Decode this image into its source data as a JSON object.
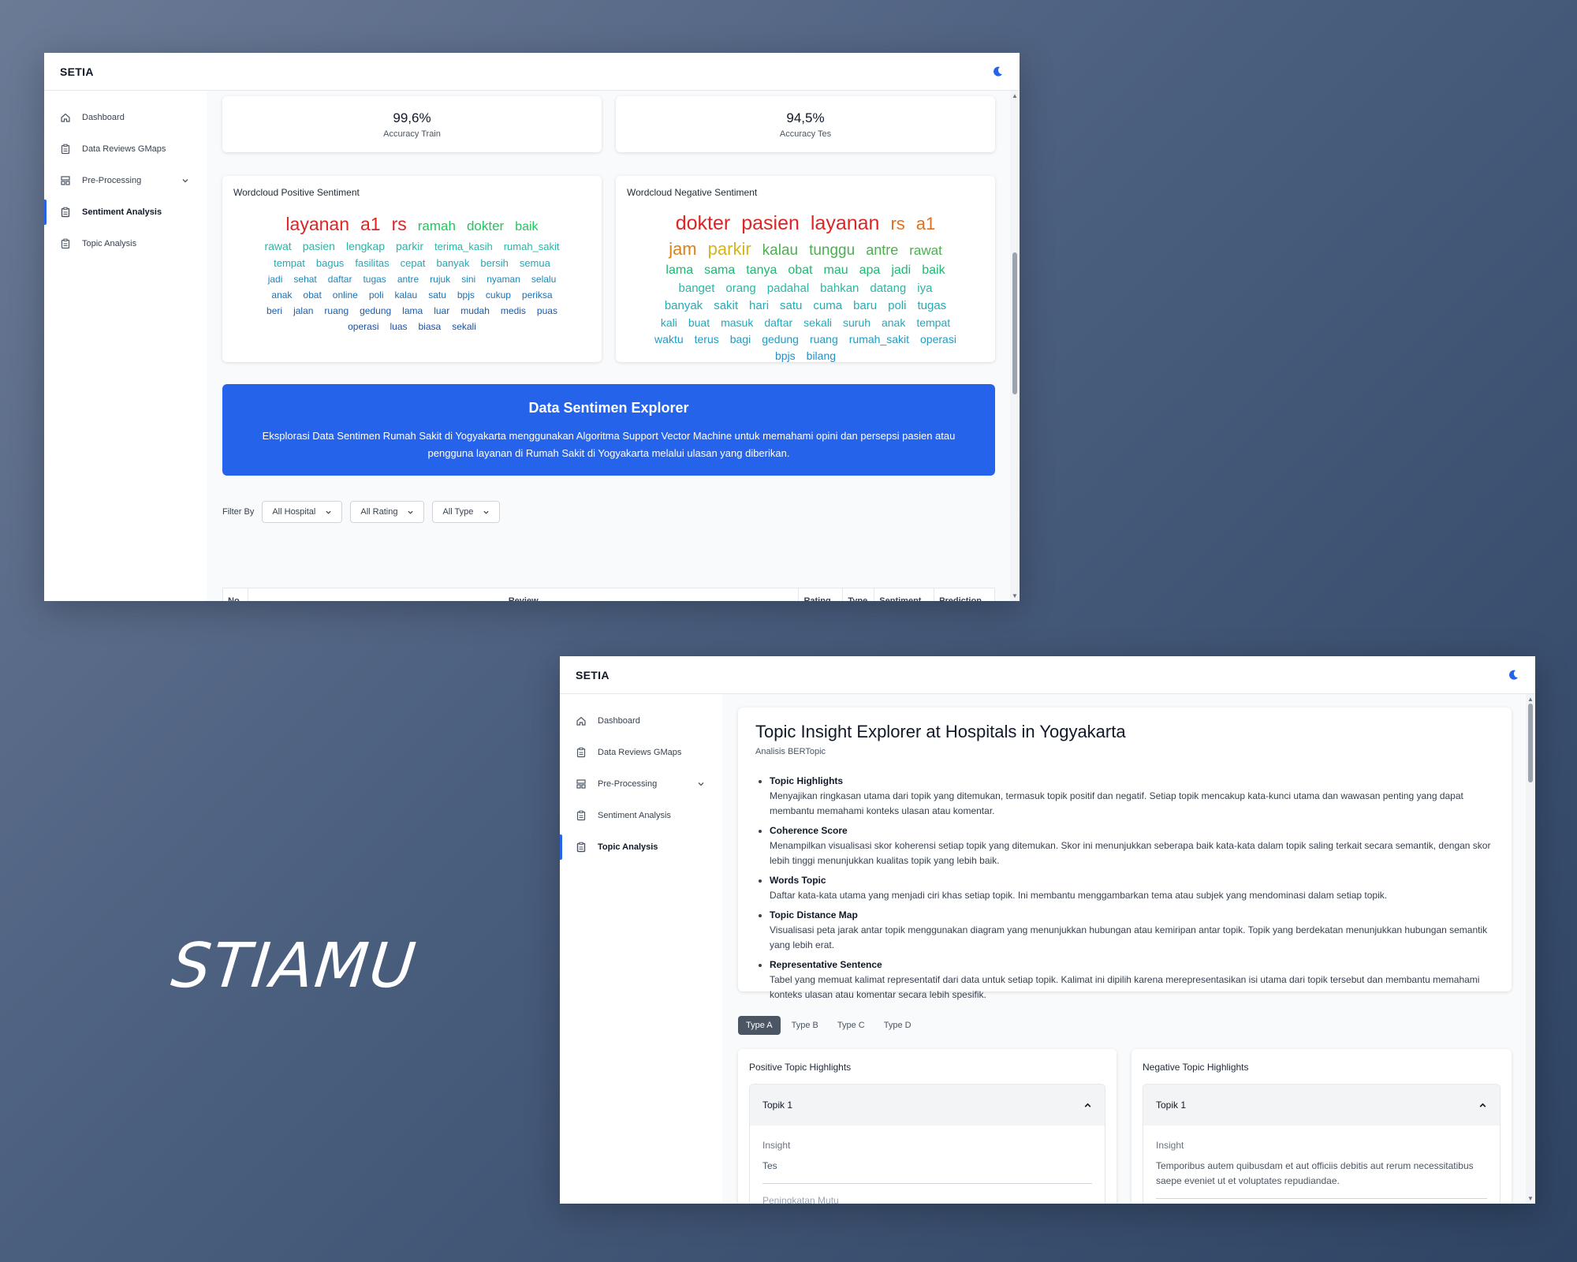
{
  "logo_text": "STIAMU",
  "app": {
    "brand": "SETIA"
  },
  "sidebar": {
    "items": [
      {
        "label": "Dashboard"
      },
      {
        "label": "Data Reviews GMaps"
      },
      {
        "label": "Pre-Processing"
      },
      {
        "label": "Sentiment Analysis"
      },
      {
        "label": "Topic Analysis"
      }
    ]
  },
  "sentiment": {
    "accuracy_train": {
      "value": "99,6%",
      "label": "Accuracy Train"
    },
    "accuracy_test": {
      "value": "94,5%",
      "label": "Accuracy Tes"
    },
    "wordcloud_positive": {
      "title": "Wordcloud Positive Sentiment",
      "rows": [
        [
          [
            "layanan",
            "#dc2626",
            23
          ],
          [
            "a1",
            "#dc2626",
            23
          ],
          [
            "rs",
            "#dc2626",
            23
          ],
          [
            "ramah",
            "#22c55e",
            17
          ],
          [
            "dokter",
            "#22c55e",
            17
          ],
          [
            "baik",
            "#22c55e",
            16
          ]
        ],
        [
          [
            "rawat",
            "#2ab5a5",
            14
          ],
          [
            "pasien",
            "#2ab5a5",
            14
          ],
          [
            "lengkap",
            "#2ab5a5",
            14
          ],
          [
            "parkir",
            "#2ab5a5",
            14
          ],
          [
            "terima_kasih",
            "#2ab5a5",
            13
          ],
          [
            "rumah_sakit",
            "#2ab5a5",
            13
          ]
        ],
        [
          [
            "tempat",
            "#22a8b8",
            13
          ],
          [
            "bagus",
            "#22a8b8",
            13
          ],
          [
            "fasilitas",
            "#22a8b8",
            13
          ],
          [
            "cepat",
            "#22a8b8",
            13
          ],
          [
            "banyak",
            "#22a8b8",
            13
          ],
          [
            "bersih",
            "#22a8b8",
            13
          ],
          [
            "semua",
            "#22a8b8",
            13
          ]
        ],
        [
          [
            "jadi",
            "#1f86b8",
            12
          ],
          [
            "sehat",
            "#1f86b8",
            12
          ],
          [
            "daftar",
            "#1f86b8",
            12
          ],
          [
            "tugas",
            "#1f86b8",
            12
          ],
          [
            "antre",
            "#1f86b8",
            12
          ],
          [
            "rujuk",
            "#1f86b8",
            12
          ],
          [
            "sini",
            "#1f86b8",
            12
          ],
          [
            "nyaman",
            "#1f86b8",
            12
          ],
          [
            "selalu",
            "#1f86b8",
            12
          ]
        ],
        [
          [
            "anak",
            "#1e6fb0",
            12
          ],
          [
            "obat",
            "#1e6fb0",
            12
          ],
          [
            "online",
            "#1e6fb0",
            12
          ],
          [
            "poli",
            "#1e6fb0",
            12
          ],
          [
            "kalau",
            "#1e6fb0",
            12
          ],
          [
            "satu",
            "#1e6fb0",
            12
          ],
          [
            "bpjs",
            "#1e6fb0",
            12
          ],
          [
            "cukup",
            "#1e6fb0",
            12
          ],
          [
            "periksa",
            "#1e6fb0",
            12
          ]
        ],
        [
          [
            "beri",
            "#1d5aa8",
            12
          ],
          [
            "jalan",
            "#1d5aa8",
            12
          ],
          [
            "ruang",
            "#1d5aa8",
            12
          ],
          [
            "gedung",
            "#1d5aa8",
            12
          ],
          [
            "lama",
            "#1d5aa8",
            12
          ],
          [
            "luar",
            "#1d5aa8",
            12
          ],
          [
            "mudah",
            "#1d5aa8",
            12
          ],
          [
            "medis",
            "#1d5aa8",
            12
          ],
          [
            "puas",
            "#1d5aa8",
            12
          ]
        ],
        [
          [
            "operasi",
            "#1d4ea0",
            12
          ],
          [
            "luas",
            "#1d4ea0",
            12
          ],
          [
            "biasa",
            "#1d4ea0",
            12
          ],
          [
            "sekali",
            "#1d4ea0",
            12
          ]
        ]
      ]
    },
    "wordcloud_negative": {
      "title": "Wordcloud Negative Sentiment",
      "rows": [
        [
          [
            "dokter",
            "#dc2626",
            25
          ],
          [
            "pasien",
            "#dc2626",
            25
          ],
          [
            "layanan",
            "#dc2626",
            25
          ],
          [
            "rs",
            "#e0701f",
            22
          ],
          [
            "a1",
            "#e0701f",
            22
          ]
        ],
        [
          [
            "jam",
            "#d9821a",
            22
          ],
          [
            "parkir",
            "#d4b51c",
            22
          ],
          [
            "kalau",
            "#4caf50",
            19
          ],
          [
            "tunggu",
            "#4caf50",
            19
          ],
          [
            "antre",
            "#4caf50",
            18
          ],
          [
            "rawat",
            "#4caf50",
            17
          ]
        ],
        [
          [
            "lama",
            "#22b573",
            16
          ],
          [
            "sama",
            "#22b573",
            16
          ],
          [
            "tanya",
            "#22b573",
            16
          ],
          [
            "obat",
            "#22b573",
            16
          ],
          [
            "mau",
            "#22b573",
            16
          ],
          [
            "apa",
            "#22b573",
            16
          ],
          [
            "jadi",
            "#22b573",
            16
          ],
          [
            "baik",
            "#22b573",
            16
          ]
        ],
        [
          [
            "banget",
            "#2ab5a5",
            15
          ],
          [
            "orang",
            "#2ab5a5",
            15
          ],
          [
            "padahal",
            "#2ab5a5",
            15
          ],
          [
            "bahkan",
            "#2ab5a5",
            15
          ],
          [
            "datang",
            "#2ab5a5",
            15
          ],
          [
            "iya",
            "#2ab5a5",
            15
          ]
        ],
        [
          [
            "banyak",
            "#24adb4",
            15
          ],
          [
            "sakit",
            "#24adb4",
            15
          ],
          [
            "hari",
            "#24adb4",
            15
          ],
          [
            "satu",
            "#24adb4",
            15
          ],
          [
            "cuma",
            "#24adb4",
            15
          ],
          [
            "baru",
            "#24adb4",
            15
          ],
          [
            "poli",
            "#24adb4",
            15
          ],
          [
            "tugas",
            "#24adb4",
            15
          ]
        ],
        [
          [
            "kali",
            "#22a8b8",
            14
          ],
          [
            "buat",
            "#22a8b8",
            14
          ],
          [
            "masuk",
            "#22a8b8",
            14
          ],
          [
            "daftar",
            "#22a8b8",
            14
          ],
          [
            "sekali",
            "#22a8b8",
            14
          ],
          [
            "suruh",
            "#22a8b8",
            14
          ],
          [
            "anak",
            "#22a8b8",
            14
          ],
          [
            "tempat",
            "#22a8b8",
            14
          ]
        ],
        [
          [
            "waktu",
            "#209cc4",
            14
          ],
          [
            "terus",
            "#209cc4",
            14
          ],
          [
            "bagi",
            "#209cc4",
            14
          ],
          [
            "gedung",
            "#209cc4",
            14
          ],
          [
            "ruang",
            "#209cc4",
            14
          ],
          [
            "rumah_sakit",
            "#209cc4",
            14
          ],
          [
            "operasi",
            "#209cc4",
            14
          ]
        ],
        [
          [
            "bpjs",
            "#1f90cc",
            14
          ],
          [
            "bilang",
            "#1f90cc",
            14
          ]
        ]
      ]
    },
    "banner": {
      "title": "Data Sentimen Explorer",
      "text": "Eksplorasi Data Sentimen Rumah Sakit di Yogyakarta menggunakan Algoritma Support Vector Machine untuk memahami opini dan persepsi pasien atau pengguna layanan di Rumah Sakit di Yogyakarta melalui ulasan yang diberikan."
    },
    "filter": {
      "label": "Filter By",
      "hospital": "All Hospital",
      "rating": "All Rating",
      "type": "All Type"
    },
    "table_headers": [
      "No",
      "Review",
      "Rating",
      "Type",
      "Sentiment",
      "Prediction"
    ]
  },
  "topic": {
    "title": "Topic Insight Explorer at Hospitals in Yogyakarta",
    "subtitle": "Analisis BERTopic",
    "bullets": [
      {
        "title": "Topic Highlights",
        "text": "Menyajikan ringkasan utama dari topik yang ditemukan, termasuk topik positif dan negatif. Setiap topik mencakup kata-kunci utama dan wawasan penting yang dapat membantu memahami konteks ulasan atau komentar."
      },
      {
        "title": "Coherence Score",
        "text": "Menampilkan visualisasi skor koherensi setiap topik yang ditemukan. Skor ini menunjukkan seberapa baik kata-kata dalam topik saling terkait secara semantik, dengan skor lebih tinggi menunjukkan kualitas topik yang lebih baik."
      },
      {
        "title": "Words Topic",
        "text": "Daftar kata-kata utama yang menjadi ciri khas setiap topik. Ini membantu menggambarkan tema atau subjek yang mendominasi dalam setiap topik."
      },
      {
        "title": "Topic Distance Map",
        "text": "Visualisasi peta jarak antar topik menggunakan diagram yang menunjukkan hubungan atau kemiripan antar topik. Topik yang berdekatan menunjukkan hubungan semantik yang lebih erat."
      },
      {
        "title": "Representative Sentence",
        "text": "Tabel yang memuat kalimat representatif dari data untuk setiap topik. Kalimat ini dipilih karena merepresentasikan isi utama dari topik tersebut dan membantu memahami konteks ulasan atau komentar secara lebih spesifik."
      }
    ],
    "tabs": [
      "Type A",
      "Type B",
      "Type C",
      "Type D"
    ],
    "positive": {
      "title": "Positive Topic Highlights",
      "topic": "Topik 1",
      "insight_label": "Insight",
      "insight_text": "Tes",
      "next_label": "Peningkatan Mutu"
    },
    "negative": {
      "title": "Negative Topic Highlights",
      "topic": "Topik 1",
      "insight_label": "Insight",
      "insight_text": "Temporibus autem quibusdam et aut officiis debitis aut rerum necessitatibus saepe eveniet ut et voluptates repudiandae."
    }
  }
}
